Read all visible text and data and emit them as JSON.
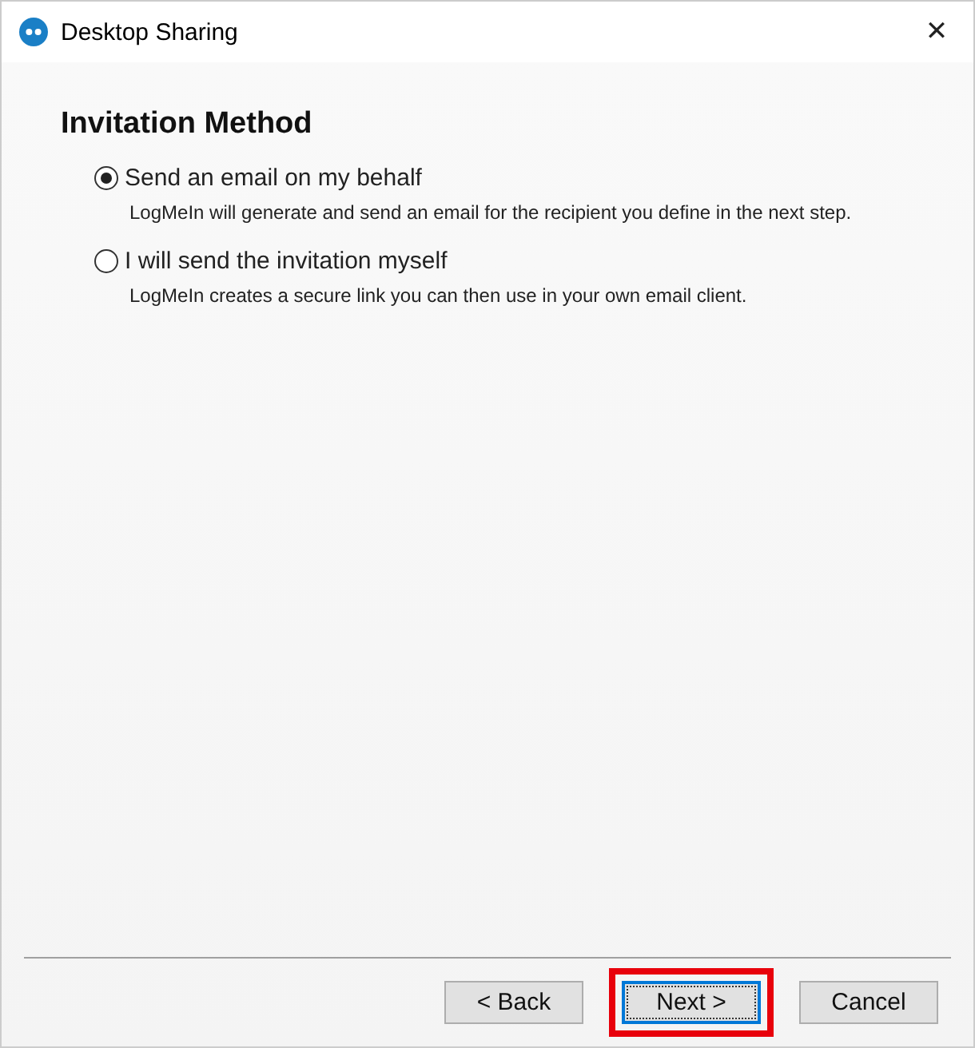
{
  "window": {
    "title": "Desktop Sharing",
    "close": "✕"
  },
  "heading": "Invitation Method",
  "options": [
    {
      "label": "Send an email on my behalf",
      "description": "LogMeIn will generate and send an email for the recipient you define in the next step.",
      "selected": true
    },
    {
      "label": "I will send the invitation myself",
      "description": "LogMeIn creates a secure link you can then use in your own email client.",
      "selected": false
    }
  ],
  "buttons": [
    {
      "label": "< Back",
      "focused": false,
      "highlighted": false
    },
    {
      "label": "Next >",
      "focused": true,
      "highlighted": true
    },
    {
      "label": "Cancel",
      "focused": false,
      "highlighted": false
    }
  ]
}
